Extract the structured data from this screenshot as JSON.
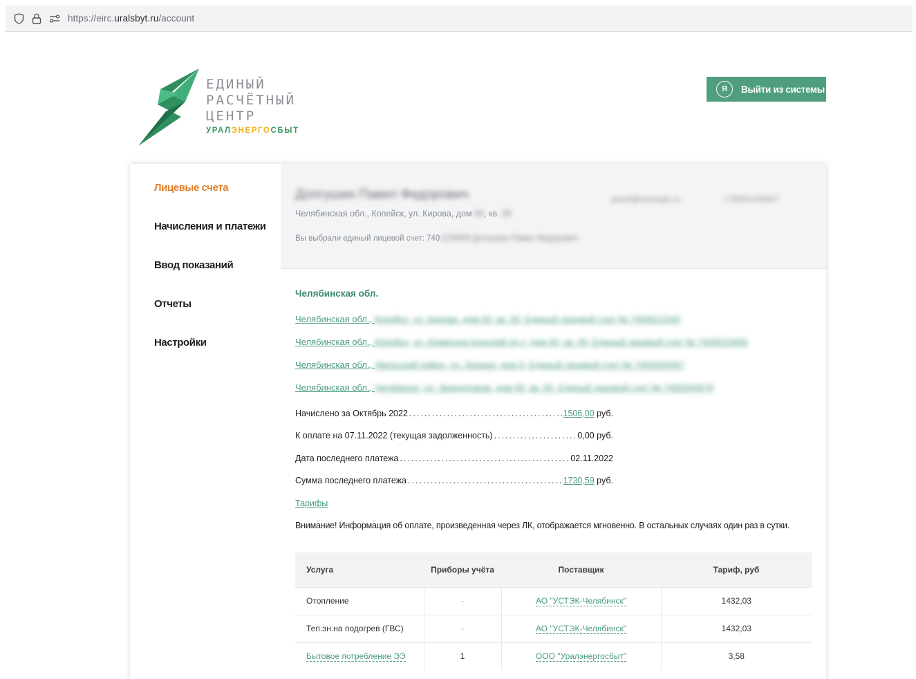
{
  "browser": {
    "url_prefix": "https://eirc.",
    "url_domain": "uralsbyt.ru",
    "url_path": "/account"
  },
  "logo": {
    "line1": "ЕДИНЫЙ",
    "line2": "РАСЧЁТНЫЙ",
    "line3": "ЦЕНТР",
    "sub_a": "УРАЛ",
    "sub_b": "ЭНЕРГО",
    "sub_c": "СБЫТ"
  },
  "header": {
    "logout_icon": "Я",
    "logout_label": "Выйти из системы"
  },
  "sidebar": {
    "items": [
      {
        "label": "Лицевые счета",
        "active": true
      },
      {
        "label": "Начисления и платежи",
        "active": false
      },
      {
        "label": "Ввод показаний",
        "active": false
      },
      {
        "label": "Отчеты",
        "active": false
      },
      {
        "label": "Настройки",
        "active": false
      }
    ]
  },
  "account": {
    "name": "Долгушин Павел Федорович",
    "address_prefix": "Челябинская обл., Копейск, ул. Кирова, дом ",
    "address_house": "00",
    "address_mid": ", кв. ",
    "address_flat": "00",
    "selected_prefix": "Вы выбрали единый лицевой счет: 740",
    "selected_rest": "1234500 Долгушин Павел Федорович",
    "email": "pavel@example.ru",
    "phone": "+79001234567"
  },
  "region": "Челябинская обл.",
  "account_links": [
    {
      "visible": "Челябинская обл., ",
      "blurred": "Копейск, ул. Кирова, дом 00, кв. 00, Единый лицевой счет № 7400012345"
    },
    {
      "visible": "Челябинская обл., ",
      "blurred": "Копейск, ул. Коммунистический пр-т, дом 00, кв. 00, Единый лицевой счет № 7400023456"
    },
    {
      "visible": "Челябинская обл., ",
      "blurred": "Увельский район, ул. Ленина, дом 0, Единый лицевой счет № 7400034567"
    },
    {
      "visible": "Челябинская обл., ",
      "blurred": "Челябинск, ул. Энергетиков, дом 00, кв. 00, Единый лицевой счет № 7400045678"
    }
  ],
  "summary": {
    "accrued_label": "Начислено за Октябрь 2022",
    "accrued_value": "1506,00",
    "accrued_unit": " руб.",
    "due_label": "К оплате на 07.11.2022 (текущая задолженность)",
    "due_value": "0,00 руб.",
    "last_date_label": "Дата последнего платежа",
    "last_date_value": "02.11.2022",
    "last_sum_label": "Сумма последнего платежа",
    "last_sum_value": "1730,59",
    "last_sum_unit": " руб."
  },
  "tariffs_link": "Тарифы",
  "notice": "Внимание! Информация об оплате, произведенная через ЛК, отображается мгновенно. В остальных случаях один раз в сутки.",
  "table": {
    "headers": [
      "Услуга",
      "Приборы учёта",
      "Поставщик",
      "Тариф, руб"
    ],
    "rows": [
      {
        "service": "Отопление",
        "meters": "-",
        "supplier": "АО \"УСТЭК-Челябинск\"",
        "tariff": "1432,03"
      },
      {
        "service": "Теп.эн.на подогрев (ГВС)",
        "meters": "-",
        "supplier": "АО \"УСТЭК-Челябинск\"",
        "tariff": "1432,03"
      },
      {
        "service": "Бытовое потребление ЭЭ",
        "meters": "1",
        "supplier": "ООО \"Уралэнергосбыт\"",
        "tariff": "3,58"
      }
    ]
  },
  "colors": {
    "brand_green": "#4f9e7e",
    "link_green": "#4c9d7c",
    "active_orange": "#e27e2a"
  }
}
